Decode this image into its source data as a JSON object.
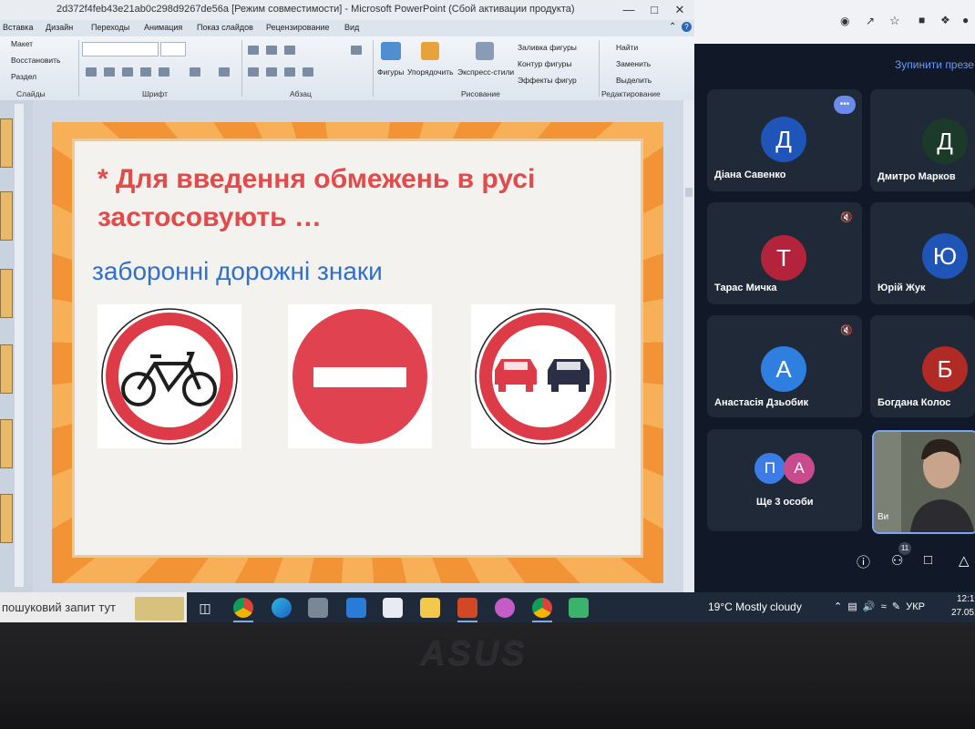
{
  "powerpoint": {
    "title": "2d372f4feb43e21ab0c298d9267de56a [Режим совместимости]  -  Microsoft PowerPoint (Сбой активации продукта)",
    "tabs": [
      "Вставка",
      "Дизайн",
      "Переходы",
      "Анимация",
      "Показ слайдов",
      "Рецензирование",
      "Вид"
    ],
    "ribbon": {
      "slides_group": {
        "label": "Слайды",
        "items": [
          "Макет",
          "Восстановить",
          "Раздел"
        ]
      },
      "font_group": {
        "label": "Шрифт"
      },
      "paragraph_group": {
        "label": "Абзац"
      },
      "drawing_group": {
        "label": "Рисование",
        "buttons": [
          "Фигуры",
          "Упорядочить",
          "Экспресс-стили"
        ],
        "items": [
          "Заливка фигуры",
          "Контур фигуры",
          "Эффекты фигур"
        ]
      },
      "editing_group": {
        "label": "Редактирование",
        "items": [
          "Найти",
          "Заменить",
          "Выделить"
        ]
      }
    }
  },
  "slide": {
    "title": "* Для введення обмежень в русі застосовують …",
    "subtitle": "заборонні дорожні знаки",
    "signs": [
      "bicycle-prohibited-sign",
      "no-entry-sign",
      "no-overtaking-sign"
    ]
  },
  "meet": {
    "stop_presenting": "Зупинити презе",
    "participants": [
      {
        "initial": "Д",
        "name": "Діана Савенко",
        "color": "#1f54b8"
      },
      {
        "initial": "Д",
        "name": "Дмитро Марков",
        "color": "#1b3a2a"
      },
      {
        "initial": "Т",
        "name": "Тарас Мичка",
        "color": "#b4233c"
      },
      {
        "initial": "Ю",
        "name": "Юрій Жук",
        "color": "#1f54b8"
      },
      {
        "initial": "А",
        "name": "Анастасія Дзьобик",
        "color": "#2f7fe0"
      },
      {
        "initial": "Б",
        "name": "Богдана Колос",
        "color": "#b02a26"
      }
    ],
    "more": {
      "initials": [
        "П",
        "А"
      ],
      "label": "Ще 3 особи",
      "colors": [
        "#3c7ce6",
        "#c94a8d"
      ]
    },
    "video_label": "Ви",
    "participant_count": "11"
  },
  "taskbar": {
    "search_text": "пошуковий запит тут",
    "weather": "19°C  Mostly cloudy",
    "language": "УКР",
    "time": "12:1",
    "date": "27.05.2"
  }
}
